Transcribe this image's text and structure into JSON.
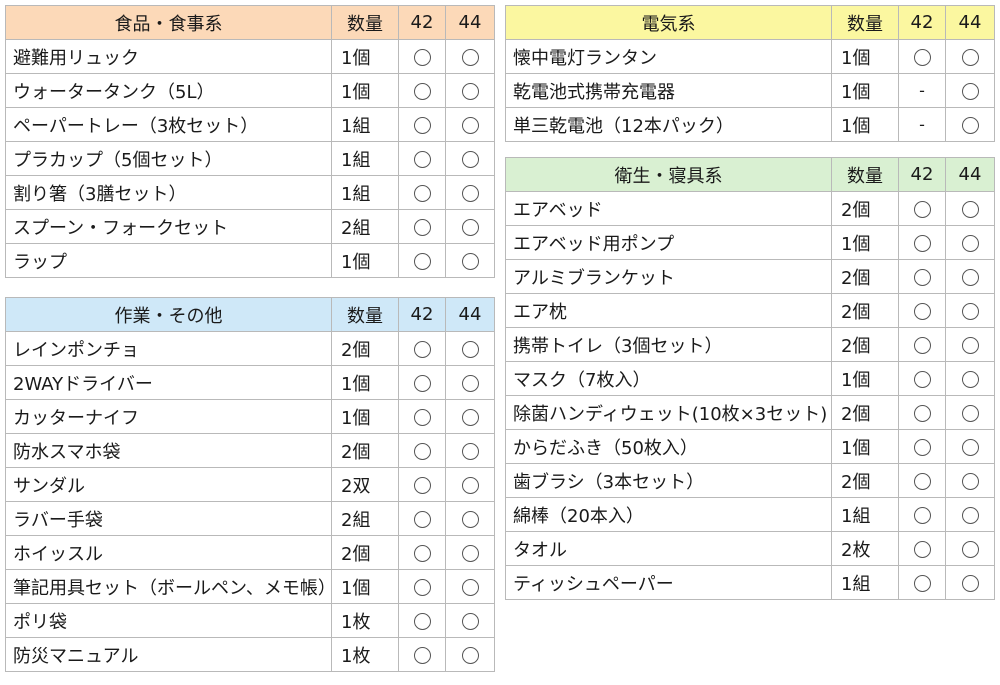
{
  "col_qty": "数量",
  "col_42": "42",
  "col_44": "44",
  "sections": {
    "food": {
      "title": "食品・食事系",
      "header_color": "#fcd9b8",
      "items": [
        {
          "name": "避難用リュック",
          "qty": "1個",
          "c42": "○",
          "c44": "○"
        },
        {
          "name": "ウォータータンク（5L）",
          "qty": "1個",
          "c42": "○",
          "c44": "○"
        },
        {
          "name": "ペーパートレー（3枚セット）",
          "qty": "1組",
          "c42": "○",
          "c44": "○"
        },
        {
          "name": "プラカップ（5個セット）",
          "qty": "1組",
          "c42": "○",
          "c44": "○"
        },
        {
          "name": "割り箸（3膳セット）",
          "qty": "1組",
          "c42": "○",
          "c44": "○"
        },
        {
          "name": "スプーン・フォークセット",
          "qty": "2組",
          "c42": "○",
          "c44": "○"
        },
        {
          "name": "ラップ",
          "qty": "1個",
          "c42": "○",
          "c44": "○"
        }
      ]
    },
    "elec": {
      "title": "電気系",
      "header_color": "#fbf7a0",
      "items": [
        {
          "name": "懐中電灯ランタン",
          "qty": "1個",
          "c42": "○",
          "c44": "○"
        },
        {
          "name": "乾電池式携帯充電器",
          "qty": "1個",
          "c42": "-",
          "c44": "○"
        },
        {
          "name": "単三乾電池（12本パック）",
          "qty": "1個",
          "c42": "-",
          "c44": "○"
        }
      ]
    },
    "work": {
      "title": "作業・その他",
      "header_color": "#cfe8f8",
      "items": [
        {
          "name": "レインポンチョ",
          "qty": "2個",
          "c42": "○",
          "c44": "○"
        },
        {
          "name": "2WAYドライバー",
          "qty": "1個",
          "c42": "○",
          "c44": "○"
        },
        {
          "name": "カッターナイフ",
          "qty": "1個",
          "c42": "○",
          "c44": "○"
        },
        {
          "name": "防水スマホ袋",
          "qty": "2個",
          "c42": "○",
          "c44": "○"
        },
        {
          "name": "サンダル",
          "qty": "2双",
          "c42": "○",
          "c44": "○"
        },
        {
          "name": "ラバー手袋",
          "qty": "2組",
          "c42": "○",
          "c44": "○"
        },
        {
          "name": "ホイッスル",
          "qty": "2個",
          "c42": "○",
          "c44": "○"
        },
        {
          "name": "筆記用具セット（ボールペン、メモ帳）",
          "qty": "1個",
          "c42": "○",
          "c44": "○"
        },
        {
          "name": "ポリ袋",
          "qty": "1枚",
          "c42": "○",
          "c44": "○"
        },
        {
          "name": "防災マニュアル",
          "qty": "1枚",
          "c42": "○",
          "c44": "○"
        }
      ]
    },
    "hyg": {
      "title": "衛生・寝具系",
      "header_color": "#d9f0d2",
      "items": [
        {
          "name": "エアベッド",
          "qty": "2個",
          "c42": "○",
          "c44": "○"
        },
        {
          "name": "エアベッド用ポンプ",
          "qty": "1個",
          "c42": "○",
          "c44": "○"
        },
        {
          "name": "アルミブランケット",
          "qty": "2個",
          "c42": "○",
          "c44": "○"
        },
        {
          "name": "エア枕",
          "qty": "2個",
          "c42": "○",
          "c44": "○"
        },
        {
          "name": "携帯トイレ（3個セット）",
          "qty": "2個",
          "c42": "○",
          "c44": "○"
        },
        {
          "name": "マスク（7枚入）",
          "qty": "1個",
          "c42": "○",
          "c44": "○"
        },
        {
          "name": "除菌ハンディウェット(10枚×3セット)",
          "qty": "2個",
          "c42": "○",
          "c44": "○"
        },
        {
          "name": "からだふき（50枚入）",
          "qty": "1個",
          "c42": "○",
          "c44": "○"
        },
        {
          "name": "歯ブラシ（3本セット）",
          "qty": "2個",
          "c42": "○",
          "c44": "○"
        },
        {
          "name": "綿棒（20本入）",
          "qty": "1組",
          "c42": "○",
          "c44": "○"
        },
        {
          "name": "タオル",
          "qty": "2枚",
          "c42": "○",
          "c44": "○"
        },
        {
          "name": "ティッシュペーパー",
          "qty": "1組",
          "c42": "○",
          "c44": "○"
        }
      ]
    }
  }
}
